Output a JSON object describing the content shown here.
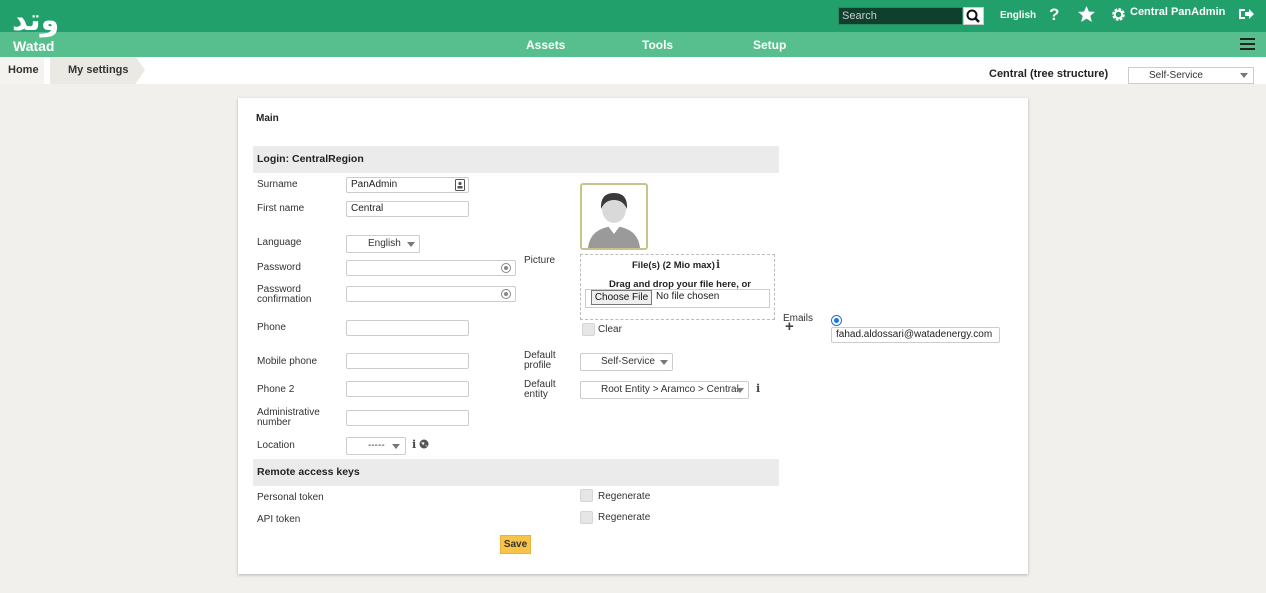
{
  "header": {
    "logo_glyph": "وتد",
    "logo_text": "Watad",
    "search_placeholder": "Search",
    "language": "English",
    "help_icon": "?",
    "user": "Central PanAdmin",
    "icons": [
      "search-icon",
      "help-icon",
      "star-icon",
      "gear-icon",
      "logout-icon"
    ]
  },
  "nav": {
    "items": [
      "Assets",
      "Tools",
      "Setup"
    ]
  },
  "breadcrumb": {
    "home": "Home",
    "current": "My settings"
  },
  "entity": {
    "label": "Central (tree structure)",
    "profile": "Self-Service"
  },
  "form": {
    "main_title": "Main",
    "login_section": "Login: CentralRegion",
    "surname_label": "Surname",
    "surname_value": "PanAdmin",
    "firstname_label": "First name",
    "firstname_value": "Central",
    "language_label": "Language",
    "language_value": "English",
    "password_label": "Password",
    "password_confirm_label": "Password confirmation",
    "phone_label": "Phone",
    "mobile_label": "Mobile phone",
    "phone2_label": "Phone 2",
    "admin_number_label": "Administrative number",
    "location_label": "Location",
    "location_value": "-----",
    "picture_label": "Picture",
    "files_title": "File(s) (2 Mio max)",
    "drag_text": "Drag and drop your file here, or",
    "choose_file": "Choose File",
    "no_file": "No file chosen",
    "clear_label": "Clear",
    "default_profile_label": "Default profile",
    "default_profile_value": "Self-Service",
    "default_entity_label": "Default entity",
    "default_entity_value": "Root Entity > Aramco > Central",
    "emails_label": "Emails",
    "email_value": "fahad.aldossari@watadenergy.com",
    "remote_section": "Remote access keys",
    "personal_token_label": "Personal token",
    "api_token_label": "API token",
    "regenerate_label": "Regenerate",
    "save_label": "Save"
  }
}
